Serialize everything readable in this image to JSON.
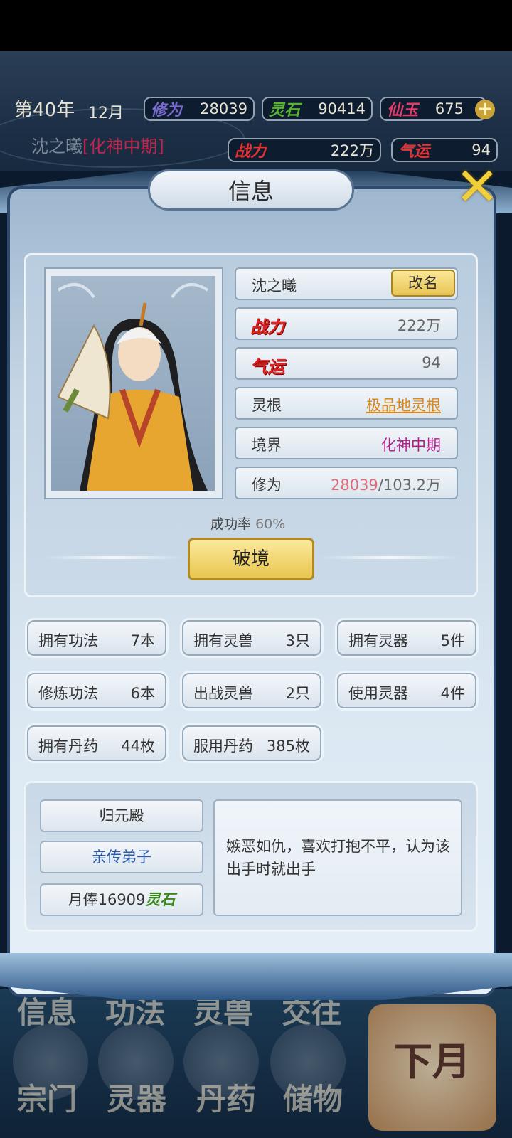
{
  "hud": {
    "year": "第40年",
    "month": "12月",
    "cultivation_label": "修为",
    "cultivation_value": "28039",
    "spirit_stone_label": "灵石",
    "spirit_stone_value": "90414",
    "jade_label": "仙玉",
    "jade_value": "675",
    "character_name": "沈之曦",
    "character_realm": "[化神中期]",
    "power_label": "战力",
    "power_value": "222万",
    "luck_label": "气运",
    "luck_value": "94",
    "plus_symbol": "+"
  },
  "modal": {
    "title": "信息",
    "close_symbol": "✕"
  },
  "info": {
    "name": "沈之曦",
    "rename_button": "改名",
    "power_label": "战力",
    "power_value": "222万",
    "luck_label": "气运",
    "luck_value": "94",
    "root_label": "灵根",
    "root_value": "极品地灵根",
    "realm_label": "境界",
    "realm_value": "化神中期",
    "cultivation_label": "修为",
    "cultivation_current": "28039",
    "cultivation_total": "/103.2万",
    "success_label": "成功率",
    "success_value": "60%",
    "breakthrough_button": "破境"
  },
  "stats": [
    {
      "label": "拥有功法",
      "value": "7本"
    },
    {
      "label": "拥有灵兽",
      "value": "3只"
    },
    {
      "label": "拥有灵器",
      "value": "5件"
    },
    {
      "label": "修炼功法",
      "value": "6本"
    },
    {
      "label": "出战灵兽",
      "value": "2只"
    },
    {
      "label": "使用灵器",
      "value": "4件"
    },
    {
      "label": "拥有丹药",
      "value": "44枚"
    },
    {
      "label": "服用丹药",
      "value": "385枚"
    }
  ],
  "sect": {
    "name": "归元殿",
    "rank": "亲传弟子",
    "salary_prefix": "月俸16909",
    "salary_currency": "灵石",
    "description": "嫉恶如仇，喜欢打抱不平，认为该出手时就出手"
  },
  "bottom_nav": {
    "row1": [
      "信息",
      "功法",
      "灵兽",
      "交往"
    ],
    "row2": [
      "宗门",
      "灵器",
      "丹药",
      "储物"
    ],
    "next_month": "下月"
  },
  "colors": {
    "accent_gold": "#e9c650",
    "realm_magenta": "#b0208a",
    "root_orange": "#d9881a",
    "power_red": "#d22222",
    "cultivation_pink": "#e06a7a",
    "sect_rank_blue": "#2a5aa8",
    "currency_green": "#3a8a1a"
  }
}
